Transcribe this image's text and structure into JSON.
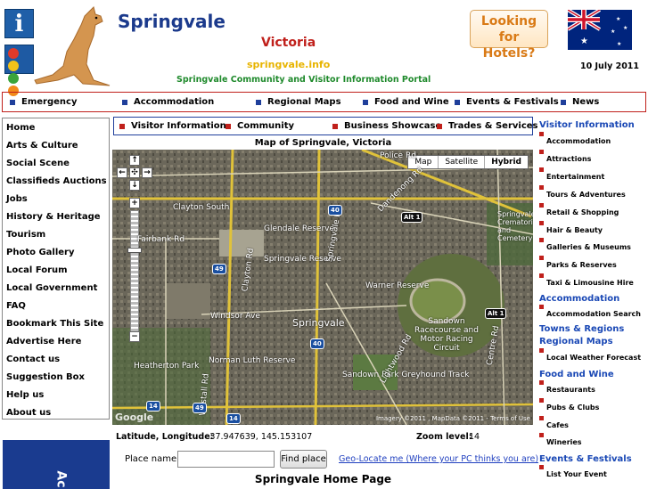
{
  "header": {
    "title": "Springvale",
    "state": "Victoria",
    "url": "springvale.info",
    "subtitle": "Springvale Community and Visitor Information Portal",
    "hotels_line1": "Looking for",
    "hotels_line2": "Hotels?",
    "date": "10 July 2011",
    "info_icon_glyph": "i"
  },
  "topnav": [
    "Emergency",
    "Accommodation",
    "Regional Maps",
    "Food and Wine",
    "Events & Festivals",
    "News"
  ],
  "leftnav": [
    "Home",
    "Arts & Culture",
    "Social Scene",
    "Classifieds Auctions",
    "Jobs",
    "History & Heritage",
    "Tourism",
    "Photo Gallery",
    "Local Forum",
    "Local Government",
    "FAQ",
    "Bookmark This Site",
    "Advertise Here",
    "Contact us",
    "Suggestion Box",
    "Help us",
    "About us"
  ],
  "leftbanner_text": "Ac",
  "subnav": [
    "Visitor Information",
    "Community",
    "Business Showcase",
    "Trades & Services"
  ],
  "map": {
    "title": "Map of Springvale, Victoria",
    "types": [
      "Map",
      "Satellite",
      "Hybrid"
    ],
    "active_type": "Hybrid",
    "copyright": "Imagery ©2011 , MapData ©2011 - Terms of Use",
    "logo": "Google",
    "labels": [
      "Clayton South",
      "Springvale",
      "Glendale Reserve",
      "Springvale Reserve",
      "Warner Reserve",
      "Sandown Racecourse and Motor Racing Circuit",
      "Norman Luth Reserve",
      "Heatherton Park",
      "Sandown Park Greyhound Track",
      "Fairbank Rd",
      "Windsor Ave",
      "Police Rd",
      "Dandenong Rd",
      "Springvale Rd",
      "Clayton Rd",
      "Westall Rd",
      "Lightwood Rd",
      "Centre Rd",
      "Springvale Crematorium and Cemetery"
    ],
    "shields": [
      "40",
      "49",
      "Alt 1",
      "Alt 1",
      "14",
      "14",
      "40",
      "49"
    ]
  },
  "coords": {
    "label": "Latitude, Longitude:",
    "value": "-37.947639, 145.153107",
    "zoom_label": "Zoom level:",
    "zoom_value": "14"
  },
  "search": {
    "label": "Place name:",
    "value": "",
    "button": "Find place",
    "geolocate": "Geo-Locate me (Where your PC thinks you are)"
  },
  "home_heading": "Springvale Home Page",
  "right_sections": [
    {
      "heading": "Visitor Information",
      "items": [
        "Accommodation",
        "Attractions",
        "Entertainment",
        "Tours & Adventures",
        "Retail & Shopping",
        "Hair & Beauty",
        "Galleries & Museums",
        "Parks & Reserves",
        "Taxi & Limousine Hire"
      ]
    },
    {
      "heading": "Accommodation",
      "items": [
        "Accommodation Search"
      ]
    },
    {
      "heading": "Towns & Regions",
      "items": []
    },
    {
      "heading": "Regional Maps",
      "items": [
        "Local Weather Forecast"
      ]
    },
    {
      "heading": "Food and Wine",
      "items": [
        "Restaurants",
        "Pubs & Clubs",
        "Cafes",
        "Wineries"
      ]
    },
    {
      "heading": "Events & Festivals",
      "items": [
        "List Your Event"
      ]
    }
  ],
  "colors": {
    "title_blue": "#1b3a8c",
    "accent_red": "#c0201b",
    "link_blue": "#1a48b5",
    "url_yellow": "#e8b400",
    "subtitle_green": "#1f8a2c"
  }
}
